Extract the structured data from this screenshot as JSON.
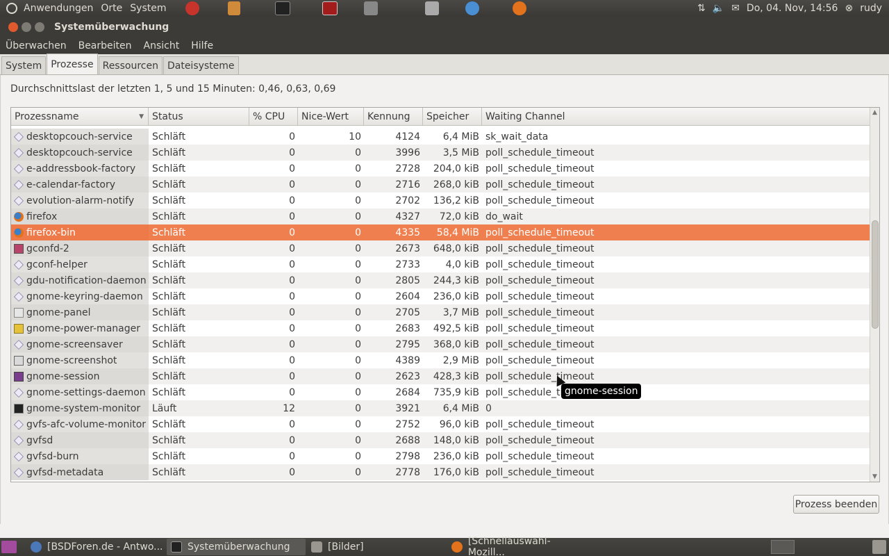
{
  "top_panel": {
    "menus": [
      "Anwendungen",
      "Orte",
      "System"
    ],
    "datetime": "Do, 04. Nov, 14:56",
    "user": "rudy"
  },
  "window": {
    "title": "Systemüberwachung",
    "menubar": [
      "Überwachen",
      "Bearbeiten",
      "Ansicht",
      "Hilfe"
    ],
    "tabs": [
      "System",
      "Prozesse",
      "Ressourcen",
      "Dateisysteme"
    ],
    "active_tab": "Prozesse"
  },
  "load_average": "Durchschnittslast der letzten 1, 5 und 15 Minuten: 0,46, 0,63, 0,69",
  "table": {
    "columns": [
      "Prozessname",
      "Status",
      "% CPU",
      "Nice-Wert",
      "Kennung",
      "Speicher",
      "Waiting Channel"
    ],
    "rows": [
      {
        "name": "desktopcouch-service",
        "status": "Schläft",
        "cpu": "0",
        "nice": "10",
        "pid": "4124",
        "mem": "6,4 MiB",
        "wchan": "sk_wait_data",
        "icon": "diamond"
      },
      {
        "name": "desktopcouch-service",
        "status": "Schläft",
        "cpu": "0",
        "nice": "0",
        "pid": "3996",
        "mem": "3,5 MiB",
        "wchan": "poll_schedule_timeout",
        "icon": "diamond"
      },
      {
        "name": "e-addressbook-factory",
        "status": "Schläft",
        "cpu": "0",
        "nice": "0",
        "pid": "2728",
        "mem": "204,0 kiB",
        "wchan": "poll_schedule_timeout",
        "icon": "diamond"
      },
      {
        "name": "e-calendar-factory",
        "status": "Schläft",
        "cpu": "0",
        "nice": "0",
        "pid": "2716",
        "mem": "268,0 kiB",
        "wchan": "poll_schedule_timeout",
        "icon": "diamond"
      },
      {
        "name": "evolution-alarm-notify",
        "status": "Schläft",
        "cpu": "0",
        "nice": "0",
        "pid": "2702",
        "mem": "136,2 kiB",
        "wchan": "poll_schedule_timeout",
        "icon": "diamond"
      },
      {
        "name": "firefox",
        "status": "Schläft",
        "cpu": "0",
        "nice": "0",
        "pid": "4327",
        "mem": "72,0 kiB",
        "wchan": "do_wait",
        "icon": "firefox"
      },
      {
        "name": "firefox-bin",
        "status": "Schläft",
        "cpu": "0",
        "nice": "0",
        "pid": "4335",
        "mem": "58,4 MiB",
        "wchan": "poll_schedule_timeout",
        "icon": "firefox",
        "selected": true
      },
      {
        "name": "gconfd-2",
        "status": "Schläft",
        "cpu": "0",
        "nice": "0",
        "pid": "2673",
        "mem": "648,0 kiB",
        "wchan": "poll_schedule_timeout",
        "icon": "gconf"
      },
      {
        "name": "gconf-helper",
        "status": "Schläft",
        "cpu": "0",
        "nice": "0",
        "pid": "2733",
        "mem": "4,0 kiB",
        "wchan": "poll_schedule_timeout",
        "icon": "diamond"
      },
      {
        "name": "gdu-notification-daemon",
        "status": "Schläft",
        "cpu": "0",
        "nice": "0",
        "pid": "2805",
        "mem": "244,3 kiB",
        "wchan": "poll_schedule_timeout",
        "icon": "diamond"
      },
      {
        "name": "gnome-keyring-daemon",
        "status": "Schläft",
        "cpu": "0",
        "nice": "0",
        "pid": "2604",
        "mem": "236,0 kiB",
        "wchan": "poll_schedule_timeout",
        "icon": "diamond"
      },
      {
        "name": "gnome-panel",
        "status": "Schläft",
        "cpu": "0",
        "nice": "0",
        "pid": "2705",
        "mem": "3,7 MiB",
        "wchan": "poll_schedule_timeout",
        "icon": "panel"
      },
      {
        "name": "gnome-power-manager",
        "status": "Schläft",
        "cpu": "0",
        "nice": "0",
        "pid": "2683",
        "mem": "492,5 kiB",
        "wchan": "poll_schedule_timeout",
        "icon": "power"
      },
      {
        "name": "gnome-screensaver",
        "status": "Schläft",
        "cpu": "0",
        "nice": "0",
        "pid": "2795",
        "mem": "368,0 kiB",
        "wchan": "poll_schedule_timeout",
        "icon": "diamond"
      },
      {
        "name": "gnome-screenshot",
        "status": "Schläft",
        "cpu": "0",
        "nice": "0",
        "pid": "4389",
        "mem": "2,9 MiB",
        "wchan": "poll_schedule_timeout",
        "icon": "camera"
      },
      {
        "name": "gnome-session",
        "status": "Schläft",
        "cpu": "0",
        "nice": "0",
        "pid": "2623",
        "mem": "428,3 kiB",
        "wchan": "poll_schedule_timeout",
        "icon": "session"
      },
      {
        "name": "gnome-settings-daemon",
        "status": "Schläft",
        "cpu": "0",
        "nice": "0",
        "pid": "2684",
        "mem": "735,9 kiB",
        "wchan": "poll_schedule_timeout",
        "icon": "diamond"
      },
      {
        "name": "gnome-system-monitor",
        "status": "Läuft",
        "cpu": "12",
        "nice": "0",
        "pid": "3921",
        "mem": "6,4 MiB",
        "wchan": "0",
        "icon": "monitor"
      },
      {
        "name": "gvfs-afc-volume-monitor",
        "status": "Schläft",
        "cpu": "0",
        "nice": "0",
        "pid": "2752",
        "mem": "96,0 kiB",
        "wchan": "poll_schedule_timeout",
        "icon": "diamond"
      },
      {
        "name": "gvfsd",
        "status": "Schläft",
        "cpu": "0",
        "nice": "0",
        "pid": "2688",
        "mem": "148,0 kiB",
        "wchan": "poll_schedule_timeout",
        "icon": "diamond"
      },
      {
        "name": "gvfsd-burn",
        "status": "Schläft",
        "cpu": "0",
        "nice": "0",
        "pid": "2798",
        "mem": "236,0 kiB",
        "wchan": "poll_schedule_timeout",
        "icon": "diamond"
      },
      {
        "name": "gvfsd-metadata",
        "status": "Schläft",
        "cpu": "0",
        "nice": "0",
        "pid": "2778",
        "mem": "176,0 kiB",
        "wchan": "poll_schedule_timeout",
        "icon": "diamond"
      }
    ]
  },
  "end_process_button": "Prozess beenden",
  "tooltip": "gnome-session",
  "taskbar": [
    {
      "label": "[BSDForen.de - Antwo...",
      "active": false
    },
    {
      "label": "Systemüberwachung",
      "active": true
    },
    {
      "label": "[Bilder]",
      "active": false
    },
    {
      "label": "[Schnellauswahl-Mozill...",
      "active": false
    }
  ],
  "colors": {
    "selection": "#ef7f4f",
    "panel": "#3c3b37"
  }
}
